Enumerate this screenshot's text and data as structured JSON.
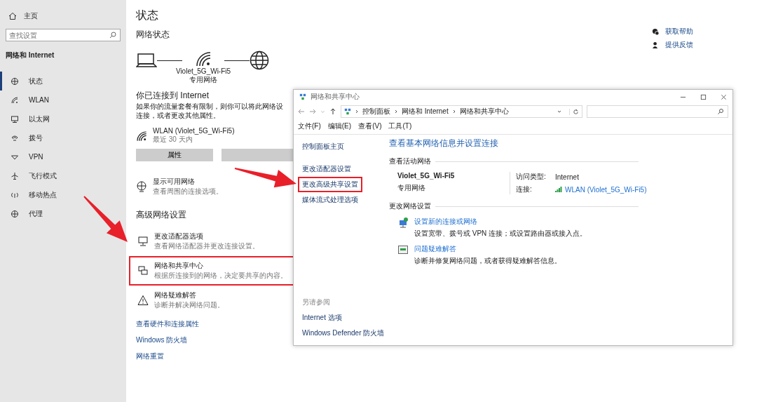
{
  "sidebar": {
    "home": "主页",
    "search": {
      "placeholder": "查找设置"
    },
    "section": "网络和 Internet",
    "items": [
      {
        "label": "状态",
        "selected": true
      },
      {
        "label": "WLAN",
        "selected": false
      },
      {
        "label": "以太网",
        "selected": false
      },
      {
        "label": "拨号",
        "selected": false
      },
      {
        "label": "VPN",
        "selected": false
      },
      {
        "label": "飞行模式",
        "selected": false
      },
      {
        "label": "移动热点",
        "selected": false
      },
      {
        "label": "代理",
        "selected": false
      }
    ]
  },
  "main": {
    "title": "状态",
    "subtitle": "网络状态",
    "diagram": {
      "network_name": "Violet_5G_Wi-Fi5",
      "network_type": "专用网络"
    },
    "connected_heading": "你已连接到 Internet",
    "description": [
      "如果你的流量套餐有限制，则你可以将此网络设",
      "连接，或者更改其他属性。"
    ],
    "connection": {
      "name": "WLAN (Violet_5G_Wi-Fi5)",
      "detail": "最近 30 天内"
    },
    "buttons": [
      {
        "label": "属性"
      }
    ],
    "show_networks": {
      "title": "显示可用网络",
      "detail": "查看周围的连接选项。"
    },
    "advanced_heading": "高级网络设置",
    "advanced_items": [
      {
        "title": "更改适配器选项",
        "detail": "查看网络适配器并更改连接设置。",
        "highlighted": false
      },
      {
        "title": "网络和共享中心",
        "detail": "根据所连接到的网络，决定要共享的内容。",
        "highlighted": true
      },
      {
        "title": "网络疑难解答",
        "detail": "诊断并解决网络问题。",
        "highlighted": false
      }
    ],
    "links": [
      "查看硬件和连接属性",
      "Windows 防火墙",
      "网络重置"
    ]
  },
  "help": [
    "获取帮助",
    "提供反馈"
  ],
  "cp_window": {
    "title": "网络和共享中心",
    "breadcrumb": [
      "控制面板",
      "网络和 Internet",
      "网络和共享中心"
    ],
    "menu": [
      "文件(F)",
      "编辑(E)",
      "查看(V)",
      "工具(T)"
    ],
    "side_links": [
      {
        "label": "控制面板主页",
        "highlighted": false
      },
      {
        "label": "更改适配器设置",
        "highlighted": false
      },
      {
        "label": "更改高级共享设置",
        "highlighted": true
      },
      {
        "label": "媒体流式处理选项",
        "highlighted": false
      }
    ],
    "heading": "查看基本网络信息并设置连接",
    "active_section": "查看活动网络",
    "network": {
      "name": "Violet_5G_Wi-Fi5",
      "type": "专用网络",
      "access_label": "访问类型:",
      "access_value": "Internet",
      "connection_label": "连接:",
      "connection_value": "WLAN (Violet_5G_Wi-Fi5)"
    },
    "change_section": "更改网络设置",
    "tasks": [
      {
        "title": "设置新的连接或网络",
        "detail": "设置宽带、拨号或 VPN 连接；或设置路由器或接入点。"
      },
      {
        "title": "问题疑难解答",
        "detail": "诊断并修复网络问题，或者获得疑难解答信息。"
      }
    ],
    "see_also_heading": "另请参阅",
    "see_also": [
      "Internet 选项",
      "Windows Defender 防火墙"
    ]
  }
}
